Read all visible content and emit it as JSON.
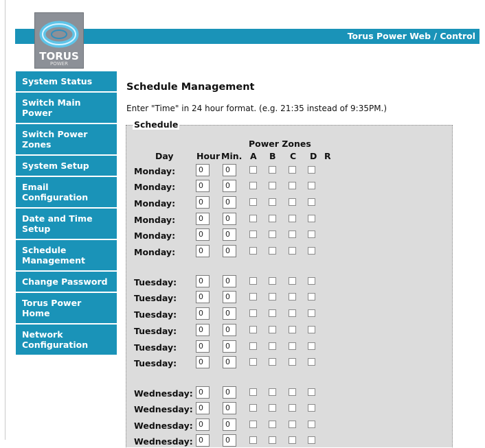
{
  "header": {
    "title": "Torus Power Web / Control"
  },
  "logo": {
    "text": "TORUS",
    "subtext": "POWER",
    "icon": "torus-ring-icon"
  },
  "sidebar": {
    "items": [
      {
        "label": "System Status"
      },
      {
        "label": "Switch Main Power"
      },
      {
        "label": "Switch Power Zones"
      },
      {
        "label": "System Setup"
      },
      {
        "label": "Email Configuration"
      },
      {
        "label": "Date and Time Setup"
      },
      {
        "label": "Schedule Management"
      },
      {
        "label": "Change Password"
      },
      {
        "label": "Torus Power Home"
      },
      {
        "label": "Network Configuration"
      }
    ]
  },
  "main": {
    "title": "Schedule Management",
    "instruction": "Enter \"Time\" in 24 hour format. (e.g. 21:35 instead of 9:35PM.)",
    "legend": "Schedule",
    "columns": {
      "day": "Day",
      "hour": "Hour",
      "min": "Min.",
      "power_zones": "Power Zones",
      "zones": [
        "A",
        "B",
        "C",
        "D",
        "R"
      ]
    },
    "rows": [
      {
        "day": "Monday:",
        "hour": "0",
        "min": "0"
      },
      {
        "day": "Monday:",
        "hour": "0",
        "min": "0"
      },
      {
        "day": "Monday:",
        "hour": "0",
        "min": "0"
      },
      {
        "day": "Monday:",
        "hour": "0",
        "min": "0"
      },
      {
        "day": "Monday:",
        "hour": "0",
        "min": "0"
      },
      {
        "day": "Monday:",
        "hour": "0",
        "min": "0"
      },
      {
        "day": "Tuesday:",
        "hour": "0",
        "min": "0"
      },
      {
        "day": "Tuesday:",
        "hour": "0",
        "min": "0"
      },
      {
        "day": "Tuesday:",
        "hour": "0",
        "min": "0"
      },
      {
        "day": "Tuesday:",
        "hour": "0",
        "min": "0"
      },
      {
        "day": "Tuesday:",
        "hour": "0",
        "min": "0"
      },
      {
        "day": "Tuesday:",
        "hour": "0",
        "min": "0"
      },
      {
        "day": "Wednesday:",
        "hour": "0",
        "min": "0"
      },
      {
        "day": "Wednesday:",
        "hour": "0",
        "min": "0"
      },
      {
        "day": "Wednesday:",
        "hour": "0",
        "min": "0"
      },
      {
        "day": "Wednesday:",
        "hour": "0",
        "min": "0"
      }
    ]
  },
  "colors": {
    "accent": "#1a93b8",
    "panel": "#dcdcdc",
    "logo_bg": "#8c9097"
  }
}
